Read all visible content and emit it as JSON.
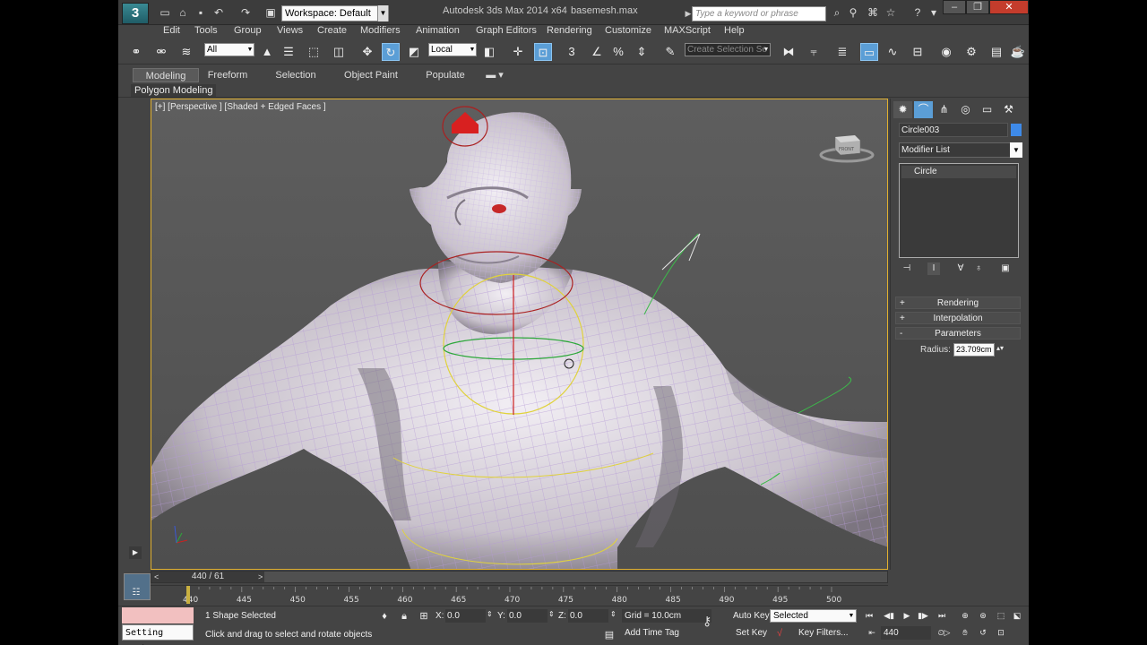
{
  "title_bar": {
    "logo": "3",
    "workspace": "Workspace: Default",
    "app_title": "Autodesk 3ds Max  2014 x64",
    "file_title": "basemesh.max",
    "search_placeholder": "Type a keyword or phrase",
    "quick_access_icons": [
      "new-file-icon",
      "open-file-icon",
      "save-icon",
      "undo-icon",
      "redo-icon",
      "project-folder-icon"
    ],
    "help_icons": [
      "binoculars-icon",
      "search-icon",
      "star-icon",
      "help-icon"
    ],
    "window_buttons": [
      "minimize",
      "restore",
      "close"
    ]
  },
  "menu": {
    "items": [
      "Edit",
      "Tools",
      "Group",
      "Views",
      "Create",
      "Modifiers",
      "Animation",
      "Graph Editors",
      "Rendering",
      "Customize",
      "MAXScript",
      "Help"
    ]
  },
  "main_toolbar": {
    "selection_filter": "All",
    "reference_coord": "Local",
    "named_selection_set": "Create Selection Se"
  },
  "ribbon": {
    "tabs": [
      "Modeling",
      "Freeform",
      "Selection",
      "Object Paint",
      "Populate"
    ],
    "active_tab": "Modeling",
    "panel_label": "Polygon Modeling"
  },
  "viewport": {
    "label": "[+] [Perspective ] [Shaded + Edged Faces ]",
    "viewcube_face": "FRONT",
    "background": "#595959",
    "border_color": "#e0b030"
  },
  "command_panel": {
    "object_name": "Circle003",
    "object_color": "#3e8ae8",
    "modifier_list": "Modifier List",
    "stack_items": [
      "Circle"
    ],
    "rollouts": [
      {
        "sign": "+",
        "label": "Rendering"
      },
      {
        "sign": "+",
        "label": "Interpolation"
      },
      {
        "sign": "-",
        "label": "Parameters"
      }
    ],
    "radius_label": "Radius:",
    "radius_value": "23.709cm"
  },
  "timeline": {
    "slider_text": "440 / 61",
    "prev": "<",
    "next": ">",
    "current_frame": 440,
    "ticks": [
      "440",
      "445",
      "450",
      "455",
      "460",
      "465",
      "470",
      "475",
      "480",
      "485",
      "490",
      "495",
      "500"
    ],
    "tick_start": 440,
    "tick_step": 5
  },
  "status": {
    "maxscript_text": "Setting Look:",
    "selection_count": "1 Shape Selected",
    "prompt": "Click and drag to select and rotate objects",
    "x_label": "X:",
    "x_value": "0.0",
    "y_label": "Y:",
    "y_value": "0.0",
    "z_label": "Z:",
    "z_value": "0.0",
    "grid": "Grid = 10.0cm",
    "add_time_tag": "Add Time Tag",
    "auto_key": "Auto Key",
    "auto_key_mode": "Selected",
    "set_key": "Set Key",
    "key_filters": "Key Filters...",
    "frame_value": "440"
  }
}
